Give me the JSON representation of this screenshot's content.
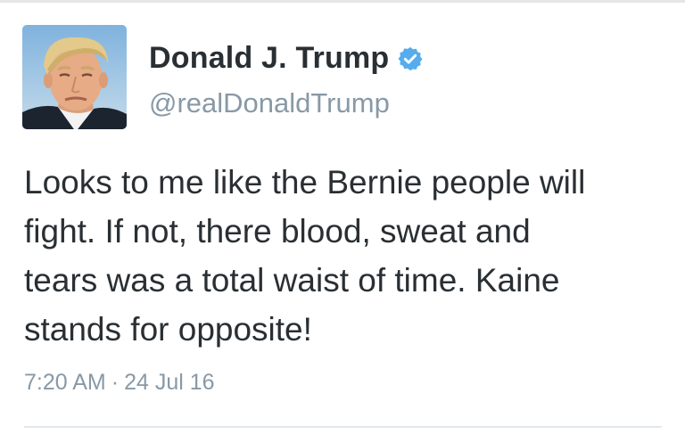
{
  "user": {
    "display_name": "Donald J. Trump",
    "handle": "@realDonaldTrump",
    "verified": true,
    "verified_icon": "verified-badge-icon",
    "verified_color": "#55acee"
  },
  "tweet": {
    "lines": [
      "Looks to me like the Bernie people will",
      "fight. If not, there blood, sweat and",
      "tears was a total waist of time. Kaine",
      "stands for opposite!"
    ],
    "time": "7:20 AM",
    "separator": "·",
    "date": "24 Jul 16"
  }
}
